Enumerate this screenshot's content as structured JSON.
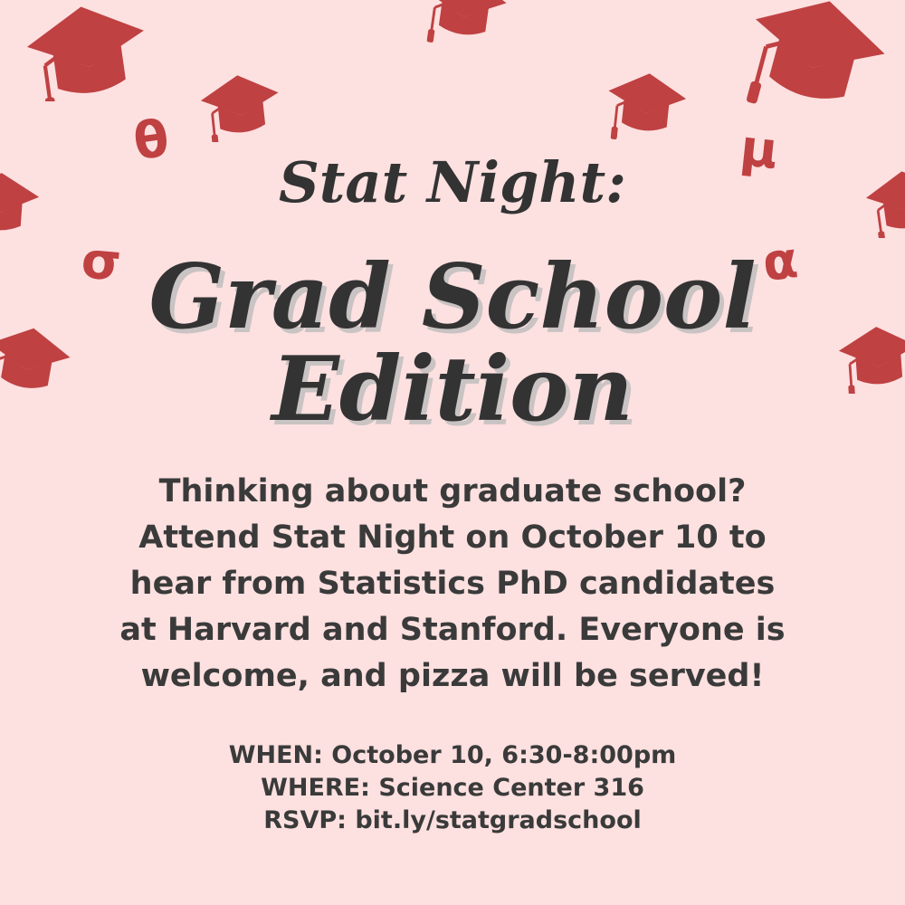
{
  "colors": {
    "background": "#fde0e0",
    "accent": "#bf4142",
    "text": "#3a3a3a"
  },
  "decorations": {
    "icon": "graduation-cap-icon",
    "greek": {
      "theta": "θ",
      "sigma": "σ",
      "mu": "μ",
      "alpha": "α"
    }
  },
  "title": {
    "line1": "Stat Night:",
    "line2": "Grad School",
    "line3": "Edition"
  },
  "body": {
    "l1": "Thinking about graduate school?",
    "l2": "Attend Stat Night on October 10 to",
    "l3": "hear from Statistics PhD candidates",
    "l4": "at Harvard and Stanford. Everyone is",
    "l5": "welcome, and pizza will be served!"
  },
  "details": {
    "when": "WHEN: October 10, 6:30-8:00pm",
    "where": "WHERE: Science Center 316",
    "rsvp": "RSVP: bit.ly/statgradschool"
  }
}
